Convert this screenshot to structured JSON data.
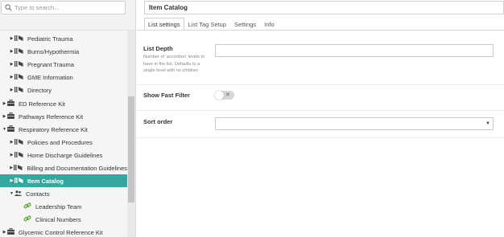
{
  "search": {
    "placeholder": "Type to search..."
  },
  "tree": {
    "items": [
      {
        "label": "Pediatric Trauma",
        "icon": "list-icon",
        "caret": "right"
      },
      {
        "label": "Burns/Hypothermia",
        "icon": "list-icon",
        "caret": "right"
      },
      {
        "label": "Pregnant Trauma",
        "icon": "list-icon",
        "caret": "right"
      },
      {
        "label": "GME Information",
        "icon": "list-icon",
        "caret": "right"
      },
      {
        "label": "Directory",
        "icon": "list-icon",
        "caret": "right"
      },
      {
        "label": "ED Reference Kit",
        "icon": "briefcase-icon",
        "caret": "right"
      },
      {
        "label": "Pathways Reference Kit",
        "icon": "briefcase-icon",
        "caret": "right"
      },
      {
        "label": "Respiratory Reference Kit",
        "icon": "briefcase-icon",
        "caret": "down"
      },
      {
        "label": "Policies and Procedures",
        "icon": "list-icon",
        "caret": "right"
      },
      {
        "label": "Home Discharge Guidelines",
        "icon": "list-icon",
        "caret": "right"
      },
      {
        "label": "Billing and Documentation Guidelines",
        "icon": "list-icon",
        "caret": "right"
      },
      {
        "label": "Item Catalog",
        "icon": "list-icon",
        "caret": "right",
        "selected": true
      },
      {
        "label": "Contacts",
        "icon": "contacts-icon",
        "caret": "down"
      },
      {
        "label": "Leadership Team",
        "icon": "link-icon",
        "caret": ""
      },
      {
        "label": "Clinical Numbers",
        "icon": "link-icon",
        "caret": ""
      },
      {
        "label": "Glycemic Control Reference Kit",
        "icon": "briefcase-icon",
        "caret": "right"
      }
    ]
  },
  "editor": {
    "title_value": "Item Catalog",
    "tabs": [
      {
        "label": "List settings"
      },
      {
        "label": "List Tag Setup"
      },
      {
        "label": "Settings"
      },
      {
        "label": "Info"
      }
    ],
    "list_depth": {
      "label": "List Depth",
      "help": "Number of 'accordion' levels to have in the list. Defaults to a single level with no children",
      "value": ""
    },
    "fast_filter": {
      "label": "Show Fast Filter",
      "enabled": false,
      "toggle_glyph": "✕"
    },
    "sort_order": {
      "label": "Sort order",
      "value": "",
      "arrow": "▼"
    }
  },
  "colors": {
    "selected_row": "#36a7a0",
    "link_icon": "#5aa832",
    "sidebar_bg": "#f2f2f2"
  }
}
